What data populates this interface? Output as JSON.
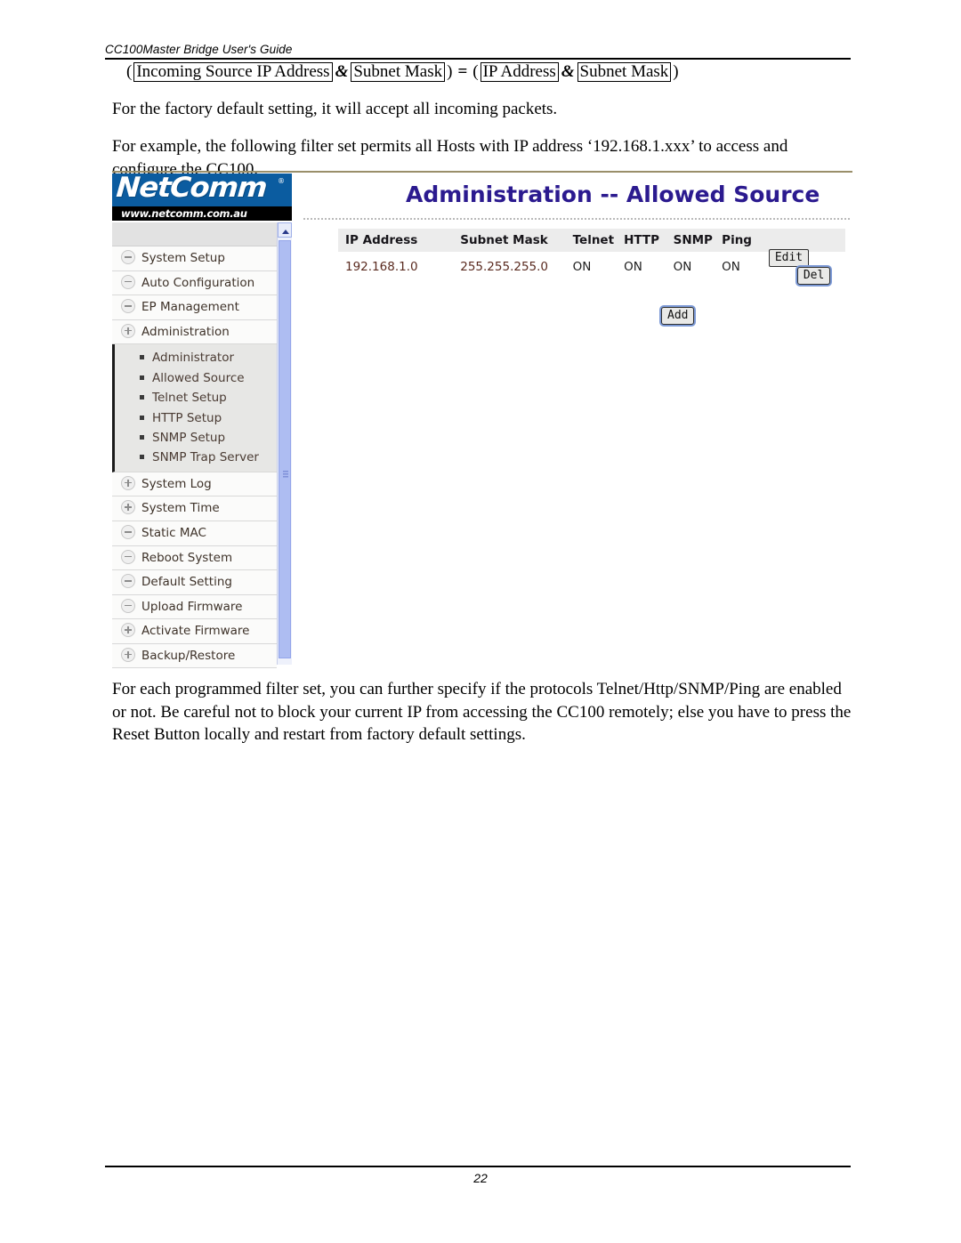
{
  "document": {
    "running_header": "CC100Master Bridge User's Guide",
    "page_number": "22"
  },
  "formula": {
    "open_paren_1": "(",
    "term_1": "Incoming Source IP Address",
    "amp_1": "&",
    "term_2": "Subnet Mask",
    "close_paren_1": ")",
    "equals": "=",
    "open_paren_2": "(",
    "term_3": "IP Address",
    "amp_2": "&",
    "term_4": "Subnet Mask",
    "close_paren_2": ")"
  },
  "paragraphs": {
    "default_setting": "For the factory default setting, it will accept all incoming packets.",
    "example": "For example, the following filter set permits all Hosts with IP address ‘192.168.1.xxx’ to access and configure the CC100,",
    "footer_note": "For each programmed filter set, you can further specify if the protocols Telnet/Http/SNMP/Ping are enabled or not. Be careful not to block your current IP from accessing the CC100 remotely; else you have to press the Reset Button locally and restart from factory default settings."
  },
  "screenshot": {
    "logo": {
      "wordmark": "NetComm",
      "registered": "®",
      "url": "www.netcomm.com.au"
    },
    "title": "Administration -- Allowed Source",
    "colors": {
      "logo_banner": "#0b5ca0",
      "title_text": "#2b1a8f",
      "table_header_bg": "#ececec",
      "row_text": "#5a2a1f",
      "scrollbar": "#aebdf2"
    },
    "sidebar": {
      "items": [
        {
          "label": "System Setup",
          "state": "minus"
        },
        {
          "label": "Auto Configuration",
          "state": "minus"
        },
        {
          "label": "EP Management",
          "state": "minus"
        },
        {
          "label": "Administration",
          "state": "plus"
        }
      ],
      "subitems": [
        {
          "label": "Administrator"
        },
        {
          "label": "Allowed Source"
        },
        {
          "label": "Telnet Setup"
        },
        {
          "label": "HTTP Setup"
        },
        {
          "label": "SNMP Setup"
        },
        {
          "label": "SNMP Trap Server"
        }
      ],
      "items_after": [
        {
          "label": "System Log",
          "state": "plus"
        },
        {
          "label": "System Time",
          "state": "plus"
        },
        {
          "label": "Static MAC",
          "state": "minus"
        },
        {
          "label": "Reboot System",
          "state": "minus"
        },
        {
          "label": "Default Setting",
          "state": "minus"
        },
        {
          "label": "Upload Firmware",
          "state": "minus"
        },
        {
          "label": "Activate Firmware",
          "state": "plus"
        },
        {
          "label": "Backup/Restore",
          "state": "plus"
        }
      ]
    },
    "table": {
      "headers": {
        "ip": "IP Address",
        "mask": "Subnet Mask",
        "telnet": "Telnet",
        "http": "HTTP",
        "snmp": "SNMP",
        "ping": "Ping"
      },
      "rows": [
        {
          "ip": "192.168.1.0",
          "mask": "255.255.255.0",
          "telnet": "ON",
          "http": "ON",
          "snmp": "ON",
          "ping": "ON",
          "edit_label": "Edit",
          "del_label": "Del"
        }
      ],
      "add_label": "Add"
    }
  }
}
